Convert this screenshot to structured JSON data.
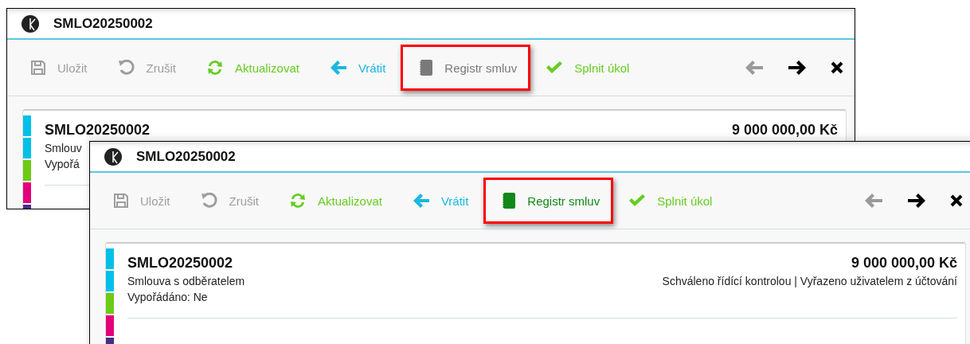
{
  "windows": [
    {
      "title": "SMLO20250002",
      "toolbar": [
        {
          "kind": "save",
          "label": "Uložit",
          "color": "#9e9e9e",
          "highlighted": false
        },
        {
          "kind": "undo",
          "label": "Zrušit",
          "color": "#9e9e9e",
          "highlighted": false
        },
        {
          "kind": "refresh",
          "label": "Aktualizovat",
          "color": "#66cc22",
          "highlighted": false
        },
        {
          "kind": "return",
          "label": "Vrátit",
          "color": "#1ab7e0",
          "highlighted": false
        },
        {
          "kind": "register",
          "label": "Registr smluv",
          "color": "#7a7a7a",
          "highlighted": true
        },
        {
          "kind": "complete",
          "label": "Splnit úkol",
          "color": "#66cc22",
          "highlighted": false
        }
      ],
      "nav": [
        {
          "kind": "back",
          "disabled": true
        },
        {
          "kind": "forward",
          "disabled": false
        },
        {
          "kind": "close",
          "disabled": false
        }
      ],
      "card": {
        "code": "SMLO20250002",
        "amount": "9 000 000,00 Kč",
        "lines": [
          "Smlouv",
          "Vypořá"
        ],
        "stripes": [
          {
            "color": "#00c0e8"
          },
          {
            "color": "#00c0e8"
          },
          {
            "color": "#6ccb14"
          },
          {
            "color": "#e2007a"
          },
          {
            "color": "#4b2a8a"
          }
        ]
      }
    },
    {
      "title": "SMLO20250002",
      "toolbar": [
        {
          "kind": "save",
          "label": "Uložit",
          "color": "#9e9e9e",
          "highlighted": false
        },
        {
          "kind": "undo",
          "label": "Zrušit",
          "color": "#9e9e9e",
          "highlighted": false
        },
        {
          "kind": "refresh",
          "label": "Aktualizovat",
          "color": "#66cc22",
          "highlighted": false
        },
        {
          "kind": "return",
          "label": "Vrátit",
          "color": "#1ab7e0",
          "highlighted": false
        },
        {
          "kind": "register",
          "label": "Registr smluv",
          "color": "#11881a",
          "highlighted": true
        },
        {
          "kind": "complete",
          "label": "Splnit úkol",
          "color": "#66cc22",
          "highlighted": false
        }
      ],
      "nav": [
        {
          "kind": "back",
          "disabled": true
        },
        {
          "kind": "forward",
          "disabled": false
        },
        {
          "kind": "close",
          "disabled": false
        }
      ],
      "card": {
        "code": "SMLO20250002",
        "amount": "9 000 000,00 Kč",
        "lines": [
          "Smlouva s odběratelem",
          "Vypořádáno: Ne"
        ],
        "status": "Schváleno řídící kontrolou | Vyřazeno uživatelem z účtování",
        "stripes": [
          {
            "color": "#00c0e8"
          },
          {
            "color": "#00c0e8"
          },
          {
            "color": "#6ccb14"
          },
          {
            "color": "#e2007a"
          },
          {
            "color": "#4b2a8a"
          }
        ]
      }
    }
  ]
}
